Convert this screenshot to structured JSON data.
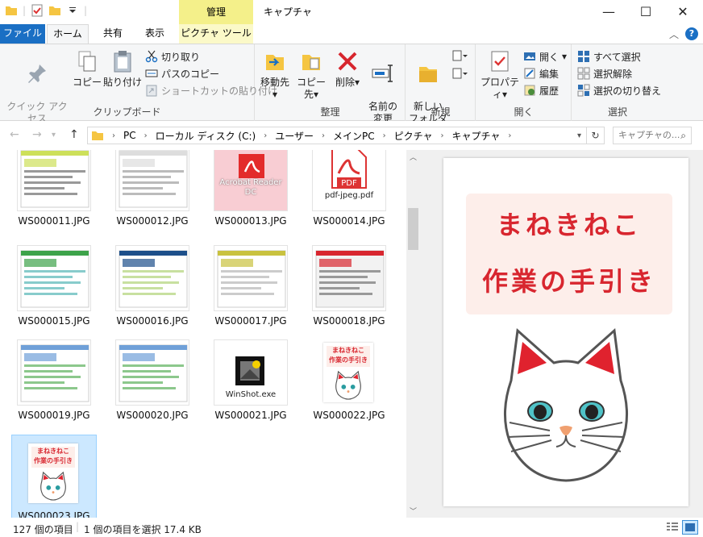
{
  "window": {
    "title": "キャプチャ",
    "context_tab": "管理",
    "minimize_icon": "minimize-icon",
    "maximize_icon": "maximize-icon",
    "close_icon": "close-icon"
  },
  "tabs": [
    {
      "label": "ファイル"
    },
    {
      "label": "ホーム"
    },
    {
      "label": "共有"
    },
    {
      "label": "表示"
    },
    {
      "label": "ピクチャ ツール"
    }
  ],
  "ribbon": {
    "clipboard": {
      "label": "クリップボード",
      "pin": "クイック アクセス\nにピン留めする",
      "copy": "コピー",
      "paste": "貼り付け",
      "cut": "切り取り",
      "copy_path": "パスのコピー",
      "paste_shortcut": "ショートカットの貼り付け"
    },
    "organize": {
      "label": "整理",
      "move_to": "移動先",
      "copy_to": "コピー先",
      "delete": "削除",
      "rename": "名前の\n変更"
    },
    "new": {
      "label": "新規",
      "new_folder": "新しい\nフォルダー"
    },
    "open": {
      "label": "開く",
      "properties": "プロパティ",
      "open": "開く",
      "edit": "編集",
      "history": "履歴"
    },
    "select": {
      "label": "選択",
      "select_all": "すべて選択",
      "select_none": "選択解除",
      "invert": "選択の切り替え"
    }
  },
  "address": {
    "crumbs": [
      "PC",
      "ローカル ディスク (C:)",
      "ユーザー",
      "メインPC",
      "ピクチャ",
      "キャプチャ"
    ],
    "search_placeholder": "キャプチャの..."
  },
  "files": [
    {
      "name": "WS000011.JPG",
      "kind": "shot-yellow"
    },
    {
      "name": "WS000012.JPG",
      "kind": "shot-text"
    },
    {
      "name": "WS000013.JPG",
      "kind": "acrobat",
      "caption": "Acrobat Reader\nDC"
    },
    {
      "name": "WS000014.JPG",
      "kind": "pdf",
      "caption": "pdf-jpeg.pdf"
    },
    {
      "name": "WS000015.JPG",
      "kind": "shot-green"
    },
    {
      "name": "WS000016.JPG",
      "kind": "shot-blue"
    },
    {
      "name": "WS000017.JPG",
      "kind": "shot-gold"
    },
    {
      "name": "WS000018.JPG",
      "kind": "shot-cat"
    },
    {
      "name": "WS000019.JPG",
      "kind": "shot-web"
    },
    {
      "name": "WS000020.JPG",
      "kind": "shot-web"
    },
    {
      "name": "WS000021.JPG",
      "kind": "winshot",
      "caption": "WinShot.exe"
    },
    {
      "name": "WS000022.JPG",
      "kind": "cat"
    },
    {
      "name": "WS000023.JPG",
      "kind": "cat",
      "selected": true
    }
  ],
  "preview": {
    "line1": "まねきねこ",
    "line2": "作業の手引き"
  },
  "cat_thumb_lines": [
    "まねきねこ",
    "作業の手引き"
  ],
  "status": {
    "count": "127 個の項目",
    "selected": "1 個の項目を選択  17.4 KB"
  }
}
